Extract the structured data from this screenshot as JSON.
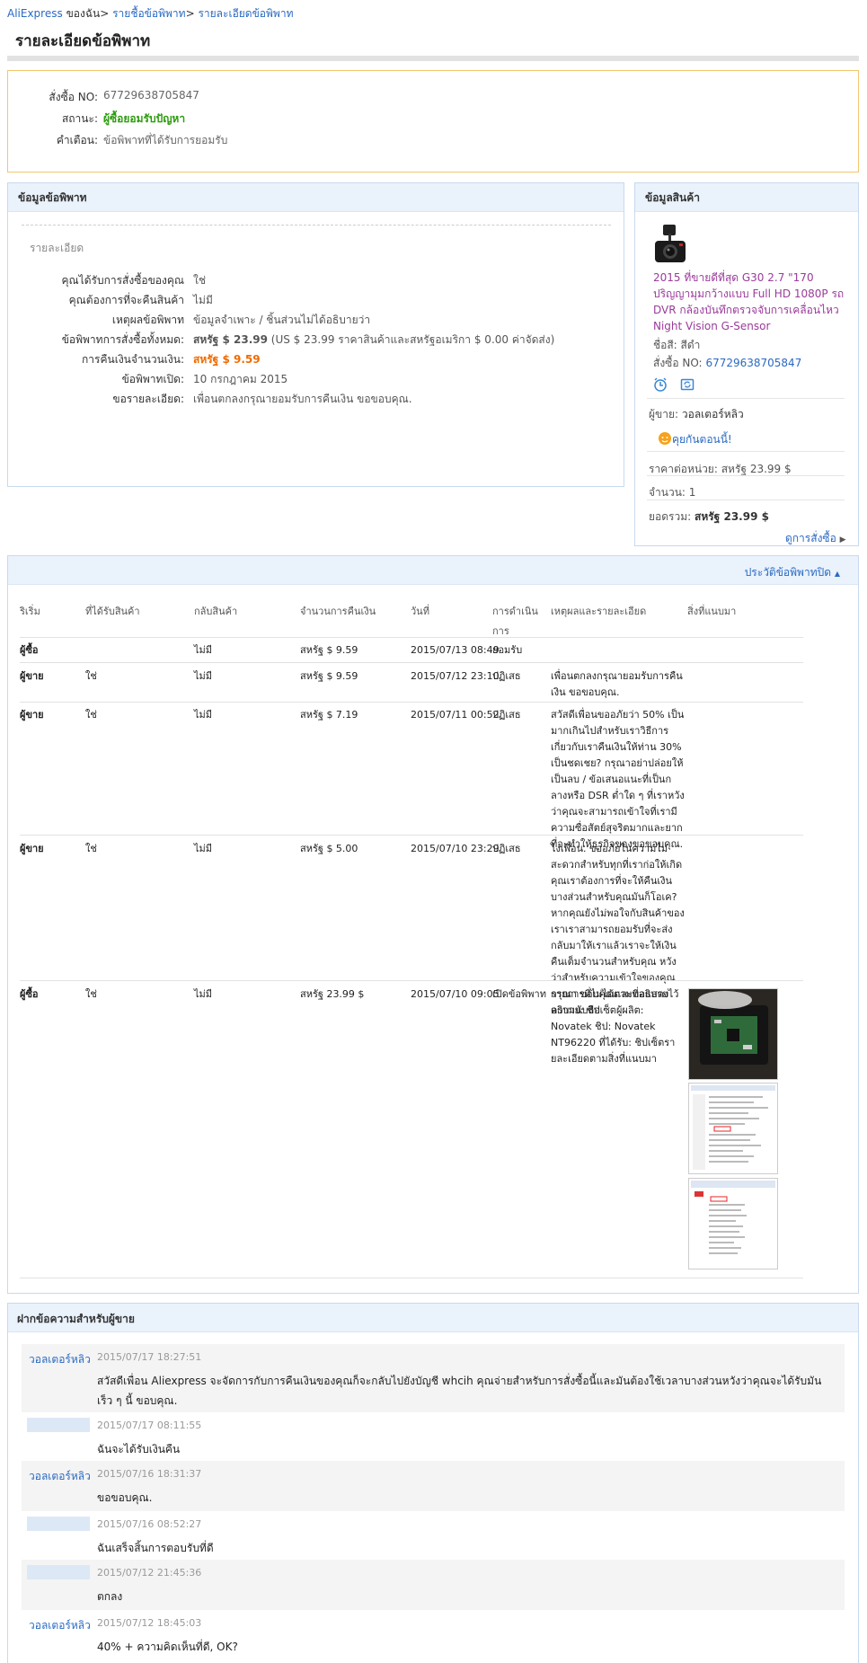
{
  "breadcrumb": {
    "home": "AliExpress",
    "mine": "ของฉัน",
    "orders": "รายชื้อข้อพิพาท",
    "current": "รายละเอียดข้อพิพาท",
    "sep": ">"
  },
  "page_title": "รายละเอียดข้อพิพาท",
  "summary": {
    "order_label": "สั่งซื้อ NO:",
    "order_value": "67729638705847",
    "status_label": "สถานะ:",
    "status_value": "ผู้ซื้อยอมรับปัญหา",
    "warning_label": "คำเตือน:",
    "warning_value": "ข้อพิพาทที่ได้รับการยอมรับ"
  },
  "dispute": {
    "panel_title": "ข้อมูลข้อพิพาท",
    "detail_heading": "รายละเอียด",
    "rows": [
      {
        "label": "คุณได้รับการสั่งซื้อของคุณ",
        "value": "ใช่"
      },
      {
        "label": "คุณต้องการที่จะคืนสินค้า",
        "value": "ไม่มี"
      },
      {
        "label": "เหตุผลข้อพิพาท",
        "value": "ข้อมูลจำเพาะ / ชิ้นส่วนไม่ได้อธิบายว่า"
      },
      {
        "label": "ข้อพิพาทการสั่งซื้อทั้งหมด:",
        "value_bold": "สหรัฐ $ 23.99",
        "value": " (US $ 23.99 ราคาสินค้าและสหรัฐอเมริกา $ 0.00 ค่าจัดส่ง)"
      },
      {
        "label": "การคืนเงินจำนวนเงิน:",
        "value": "สหรัฐ $ 9.59"
      },
      {
        "label": "ข้อพิพาทเปิด:",
        "value": "10 กรกฎาคม 2015"
      },
      {
        "label": "ขอรายละเอียด:",
        "value": "เพื่อนตกลงกรุณายอมรับการคืนเงิน ขอขอบคุณ."
      }
    ]
  },
  "product": {
    "panel_title": "ข้อมูลสินค้า",
    "name": "2015 ที่ขายดีที่สุด G30 2.7 \"170 ปริญญามุมกว้างแบบ Full HD 1080P รถ DVR กล้องบันทึกตรวจจับการเคลื่อนไหว Night Vision G-Sensor",
    "color_label": "ชื่อสี:",
    "color_value": "สีดำ",
    "order_label": "สั่งซื้อ NO:",
    "order_value": "67729638705847",
    "seller_label": "ผู้ขาย:",
    "seller_value": "วอลเตอร์หลิว",
    "chat_label": "คุยกันตอนนี้!",
    "unit_price_label": "ราคาต่อหน่วย:",
    "unit_price_value": "สหรัฐ 23.99 $",
    "quantity_label": "จำนวน:",
    "quantity_value": "1",
    "total_label": "ยอดรวม:",
    "total_value": "สหรัฐ 23.99 $",
    "view_order": "ดูการสั่งซื้อ"
  },
  "history": {
    "toggle": "ประวัติข้อพิพาทปิด",
    "columns": [
      "ริเริ่ม",
      "ที่ได้รับสินค้า",
      "กลับสินค้า",
      "จำนวนการคืนเงิน",
      "วันที่",
      "การดำเนิน การ",
      "เหตุผลและรายละเอียด",
      "สิ่งที่แนบมา"
    ],
    "rows": [
      {
        "initiator": "ผู้ซื้อ",
        "received": "",
        "returned": "ไม่มี",
        "amount": "สหรัฐ $ 9.59",
        "date": "2015/07/13 08:49",
        "action": "ยอมรับ",
        "reason": ""
      },
      {
        "initiator": "ผู้ขาย",
        "received": "ใช่",
        "returned": "ไม่มี",
        "amount": "สหรัฐ $ 9.59",
        "date": "2015/07/12 23:10",
        "action": "ปฏิเสธ",
        "reason": "เพื่อนตกลงกรุณายอมรับการคืนเงิน ขอขอบคุณ."
      },
      {
        "initiator": "ผู้ขาย",
        "received": "ใช่",
        "returned": "ไม่มี",
        "amount": "สหรัฐ $ 7.19",
        "date": "2015/07/11 00:52",
        "action": "ปฏิเสธ",
        "reason": "สวัสดีเพื่อนขออภัยว่า 50% เป็นมากเกินไปสำหรับเราวิธีการเกี่ยวกับเราคืนเงินให้ท่าน 30% เป็นชดเชย? กรุณาอย่าปล่อยให้เป็นลบ / ข้อเสนอแนะที่เป็นกลางหรือ DSR ต่ำใด ๆ ที่เราหวังว่าคุณจะสามารถเข้าใจที่เรามีความซื่อสัตย์สุจริตมากและยากที่จะทำให้ธุรกิจของขอขอบคุณ."
      },
      {
        "initiator": "ผู้ขาย",
        "received": "ใช่",
        "returned": "ไม่มี",
        "amount": "สหรัฐ $ 5.00",
        "date": "2015/07/10 23:29",
        "action": "ปฏิเสธ",
        "reason": "ไงเพื่อน. ขออภัยในความไม่สะดวกสำหรับทุกที่เราก่อให้เกิดคุณเราต้องการที่จะให้คืนเงินบางส่วนสำหรับคุณมันก็โอเค? หากคุณยังไม่พอใจกับสินค้าของเราเราสามารถยอมรับที่จะส่งกลับมาให้เราแล้วเราจะให้เงินคืนเต็มจำนวนสำหรับคุณ หวังว่าสำหรับความเข้าใจของคุณกรุณา ขอบคุณและขอแสดงความนับถือ"
      },
      {
        "initiator": "ผู้ซื้อ",
        "received": "ใช่",
        "returned": "ไม่มี",
        "amount": "สหรัฐ 23.99 $",
        "date": "2015/07/10 09:05",
        "action": "เปิดข้อพิพาท",
        "reason": "รายการที่ไม่ได้ตามที่อธิบายไว้ อธิบาย: ชิปเซ็ตผู้ผลิต: Novatek ชิป: Novatek NT96220 ที่ได้รับ: ชิปเซ็ตรายละเอียดตามสิ่งที่แนบมา"
      }
    ]
  },
  "messages": {
    "panel_title": "ฝากข้อความสำหรับผู้ขาย",
    "items": [
      {
        "author": "วอลเตอร์หลิว",
        "time": "2015/07/17 18:27:51",
        "text": "สวัสดีเพื่อน Aliexpress จะจัดการกับการคืนเงินของคุณก็จะกลับไปยังบัญชี whcih คุณจ่ายสำหรับการสั่งซื้อนี้และมันต้องใช้เวลาบางส่วนหวังว่าคุณจะได้รับมันเร็ว ๆ นี้ ขอบคุณ."
      },
      {
        "author": "",
        "time": "2015/07/17 08:11:55",
        "text": "ฉันจะได้รับเงินคืน"
      },
      {
        "author": "วอลเตอร์หลิว",
        "time": "2015/07/16 18:31:37",
        "text": "ขอขอบคุณ."
      },
      {
        "author": "",
        "time": "2015/07/16 08:52:27",
        "text": "ฉันเสร็จสิ้นการตอบรับที่ดี"
      },
      {
        "author": "",
        "time": "2015/07/12 21:45:36",
        "text": "ตกลง"
      },
      {
        "author": "วอลเตอร์หลิว",
        "time": "2015/07/12 18:45:03",
        "text": "40% + ความคิดเห็นที่ดี, OK?"
      }
    ]
  },
  "colors": {
    "link": "#2a6ac3",
    "status_green": "#2d9c0e",
    "refund_orange": "#f06b00",
    "product_purple": "#9a3b9a",
    "panel_header": "#eaf2fc",
    "summary_border": "#f2c66d"
  },
  "icons": [
    "clock-icon",
    "refresh-icon",
    "chat-icon",
    "chevron-up-icon",
    "chevron-right-icon"
  ]
}
